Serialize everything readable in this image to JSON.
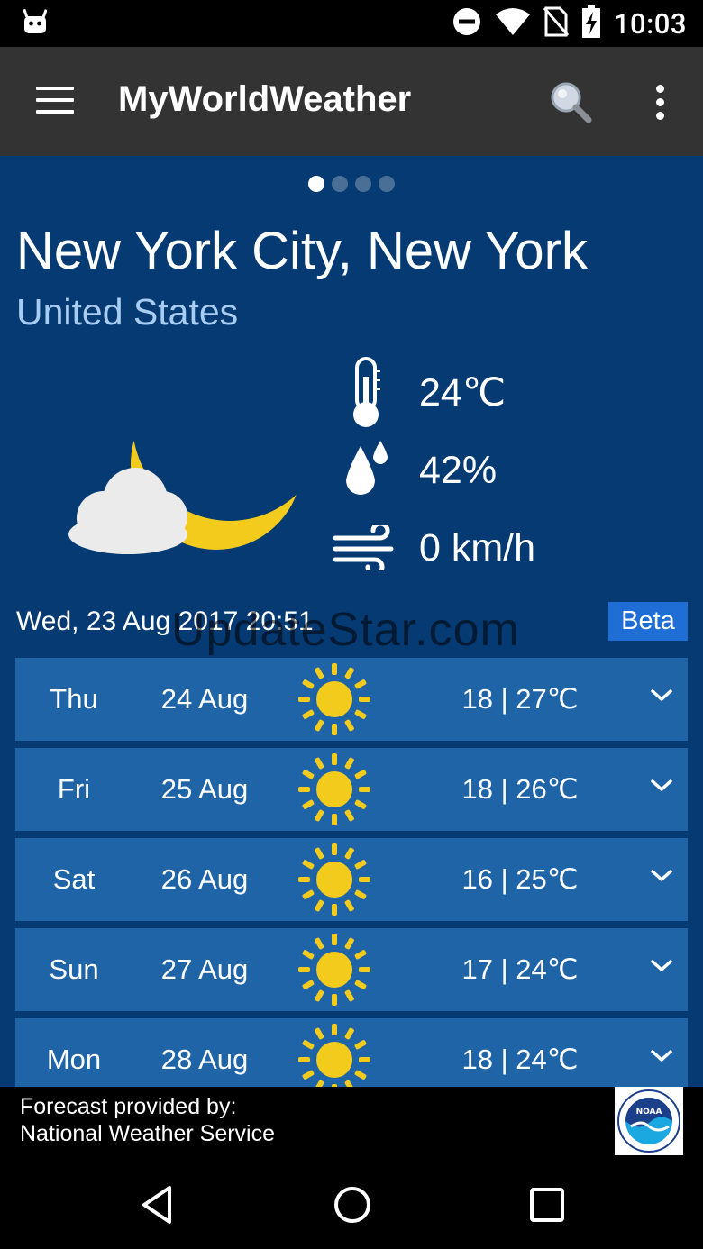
{
  "status_bar": {
    "time": "10:03",
    "icons": [
      "android-icon",
      "dnd-icon",
      "wifi-icon",
      "no-sim-icon",
      "battery-charging-icon"
    ]
  },
  "app_bar": {
    "title": "MyWorldWeather",
    "icons": [
      "menu-icon",
      "search-icon",
      "more-vert-icon"
    ]
  },
  "location": {
    "city": "New York City, New York",
    "country": "United States",
    "page_count": 4,
    "active_page": 1
  },
  "current": {
    "condition_icon": "moon-cloud-icon",
    "temperature": "24℃",
    "humidity": "42%",
    "wind": "0 km/h",
    "observed": "Wed, 23 Aug 2017 20:51",
    "badge": "Beta"
  },
  "watermark": "UpdateStar.com",
  "forecast": [
    {
      "day": "Thu",
      "date": "24 Aug",
      "icon": "sun-icon",
      "temps": "18 | 27℃"
    },
    {
      "day": "Fri",
      "date": "25 Aug",
      "icon": "sun-icon",
      "temps": "18 | 26℃"
    },
    {
      "day": "Sat",
      "date": "26 Aug",
      "icon": "sun-icon",
      "temps": "16 | 25℃"
    },
    {
      "day": "Sun",
      "date": "27 Aug",
      "icon": "sun-icon",
      "temps": "17 | 24℃"
    },
    {
      "day": "Mon",
      "date": "28 Aug",
      "icon": "sun-icon",
      "temps": "18 | 24℃"
    }
  ],
  "footer": {
    "line1": "Forecast provided by:",
    "line2": "National Weather Service",
    "logo_text": "NOAA"
  },
  "colors": {
    "content_bg": "#063a72",
    "row_bg": "#1e64a7",
    "country": "#a9ccf2",
    "beta_bg": "#1e6ed6",
    "sun": "#f2cb1d",
    "moon": "#f2cb1d"
  }
}
